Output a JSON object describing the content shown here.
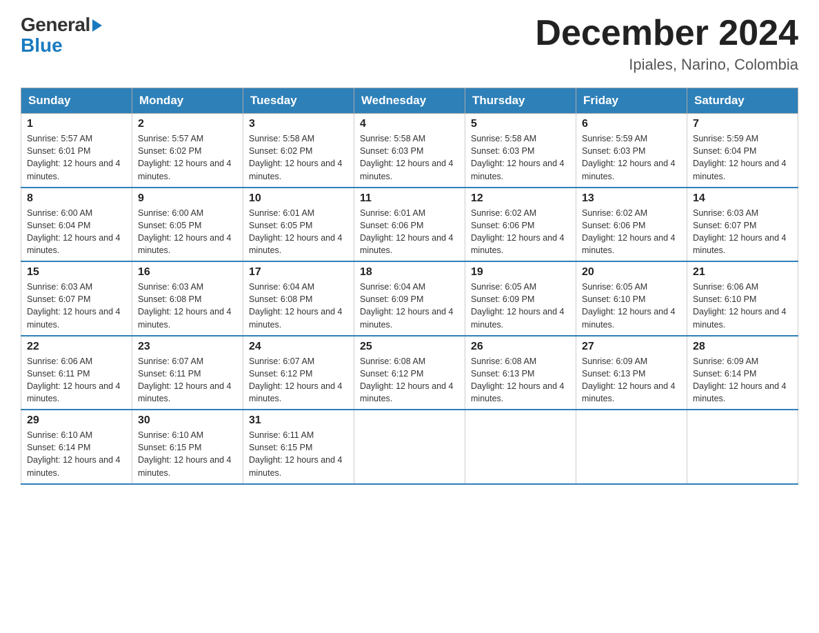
{
  "logo": {
    "general": "General",
    "blue": "Blue"
  },
  "title": "December 2024",
  "location": "Ipiales, Narino, Colombia",
  "days_of_week": [
    "Sunday",
    "Monday",
    "Tuesday",
    "Wednesday",
    "Thursday",
    "Friday",
    "Saturday"
  ],
  "weeks": [
    [
      {
        "day": "1",
        "sunrise": "5:57 AM",
        "sunset": "6:01 PM",
        "daylight": "12 hours and 4 minutes."
      },
      {
        "day": "2",
        "sunrise": "5:57 AM",
        "sunset": "6:02 PM",
        "daylight": "12 hours and 4 minutes."
      },
      {
        "day": "3",
        "sunrise": "5:58 AM",
        "sunset": "6:02 PM",
        "daylight": "12 hours and 4 minutes."
      },
      {
        "day": "4",
        "sunrise": "5:58 AM",
        "sunset": "6:03 PM",
        "daylight": "12 hours and 4 minutes."
      },
      {
        "day": "5",
        "sunrise": "5:58 AM",
        "sunset": "6:03 PM",
        "daylight": "12 hours and 4 minutes."
      },
      {
        "day": "6",
        "sunrise": "5:59 AM",
        "sunset": "6:03 PM",
        "daylight": "12 hours and 4 minutes."
      },
      {
        "day": "7",
        "sunrise": "5:59 AM",
        "sunset": "6:04 PM",
        "daylight": "12 hours and 4 minutes."
      }
    ],
    [
      {
        "day": "8",
        "sunrise": "6:00 AM",
        "sunset": "6:04 PM",
        "daylight": "12 hours and 4 minutes."
      },
      {
        "day": "9",
        "sunrise": "6:00 AM",
        "sunset": "6:05 PM",
        "daylight": "12 hours and 4 minutes."
      },
      {
        "day": "10",
        "sunrise": "6:01 AM",
        "sunset": "6:05 PM",
        "daylight": "12 hours and 4 minutes."
      },
      {
        "day": "11",
        "sunrise": "6:01 AM",
        "sunset": "6:06 PM",
        "daylight": "12 hours and 4 minutes."
      },
      {
        "day": "12",
        "sunrise": "6:02 AM",
        "sunset": "6:06 PM",
        "daylight": "12 hours and 4 minutes."
      },
      {
        "day": "13",
        "sunrise": "6:02 AM",
        "sunset": "6:06 PM",
        "daylight": "12 hours and 4 minutes."
      },
      {
        "day": "14",
        "sunrise": "6:03 AM",
        "sunset": "6:07 PM",
        "daylight": "12 hours and 4 minutes."
      }
    ],
    [
      {
        "day": "15",
        "sunrise": "6:03 AM",
        "sunset": "6:07 PM",
        "daylight": "12 hours and 4 minutes."
      },
      {
        "day": "16",
        "sunrise": "6:03 AM",
        "sunset": "6:08 PM",
        "daylight": "12 hours and 4 minutes."
      },
      {
        "day": "17",
        "sunrise": "6:04 AM",
        "sunset": "6:08 PM",
        "daylight": "12 hours and 4 minutes."
      },
      {
        "day": "18",
        "sunrise": "6:04 AM",
        "sunset": "6:09 PM",
        "daylight": "12 hours and 4 minutes."
      },
      {
        "day": "19",
        "sunrise": "6:05 AM",
        "sunset": "6:09 PM",
        "daylight": "12 hours and 4 minutes."
      },
      {
        "day": "20",
        "sunrise": "6:05 AM",
        "sunset": "6:10 PM",
        "daylight": "12 hours and 4 minutes."
      },
      {
        "day": "21",
        "sunrise": "6:06 AM",
        "sunset": "6:10 PM",
        "daylight": "12 hours and 4 minutes."
      }
    ],
    [
      {
        "day": "22",
        "sunrise": "6:06 AM",
        "sunset": "6:11 PM",
        "daylight": "12 hours and 4 minutes."
      },
      {
        "day": "23",
        "sunrise": "6:07 AM",
        "sunset": "6:11 PM",
        "daylight": "12 hours and 4 minutes."
      },
      {
        "day": "24",
        "sunrise": "6:07 AM",
        "sunset": "6:12 PM",
        "daylight": "12 hours and 4 minutes."
      },
      {
        "day": "25",
        "sunrise": "6:08 AM",
        "sunset": "6:12 PM",
        "daylight": "12 hours and 4 minutes."
      },
      {
        "day": "26",
        "sunrise": "6:08 AM",
        "sunset": "6:13 PM",
        "daylight": "12 hours and 4 minutes."
      },
      {
        "day": "27",
        "sunrise": "6:09 AM",
        "sunset": "6:13 PM",
        "daylight": "12 hours and 4 minutes."
      },
      {
        "day": "28",
        "sunrise": "6:09 AM",
        "sunset": "6:14 PM",
        "daylight": "12 hours and 4 minutes."
      }
    ],
    [
      {
        "day": "29",
        "sunrise": "6:10 AM",
        "sunset": "6:14 PM",
        "daylight": "12 hours and 4 minutes."
      },
      {
        "day": "30",
        "sunrise": "6:10 AM",
        "sunset": "6:15 PM",
        "daylight": "12 hours and 4 minutes."
      },
      {
        "day": "31",
        "sunrise": "6:11 AM",
        "sunset": "6:15 PM",
        "daylight": "12 hours and 4 minutes."
      },
      null,
      null,
      null,
      null
    ]
  ],
  "labels": {
    "sunrise_prefix": "Sunrise: ",
    "sunset_prefix": "Sunset: ",
    "daylight_prefix": "Daylight: "
  },
  "colors": {
    "header_bg": "#2e80b8",
    "header_text": "#ffffff",
    "logo_blue": "#1a7abf",
    "title_color": "#222222",
    "location_color": "#555555"
  }
}
